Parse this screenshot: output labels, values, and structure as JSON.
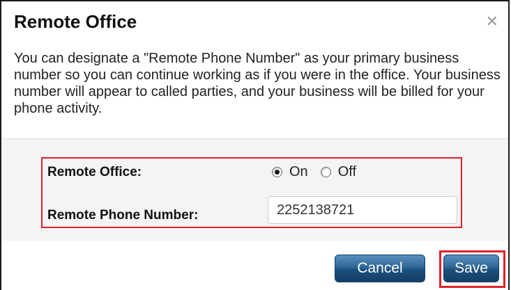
{
  "dialog": {
    "title": "Remote Office",
    "close_icon": "close-icon",
    "description": "You can designate a \"Remote Phone Number\" as your primary business number so you can continue working as if you were in the office. Your business number will appear to called parties, and your business will be billed for your phone activity."
  },
  "form": {
    "remote_office_label": "Remote Office:",
    "remote_office_options": [
      {
        "label": "On",
        "checked": true
      },
      {
        "label": "Off",
        "checked": false
      }
    ],
    "remote_phone_label": "Remote Phone Number:",
    "remote_phone_value": "2252138721"
  },
  "buttons": {
    "cancel_label": "Cancel",
    "save_label": "Save"
  },
  "colors": {
    "highlight": "#e0202a",
    "button_blue": "#1d4f7c"
  }
}
